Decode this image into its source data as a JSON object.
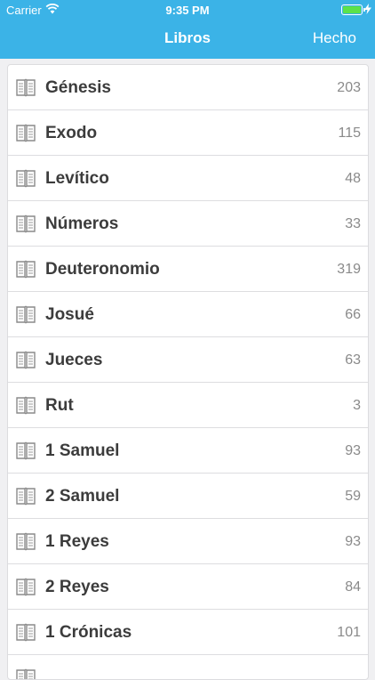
{
  "status_bar": {
    "carrier": "Carrier",
    "time": "9:35 PM"
  },
  "nav": {
    "title": "Libros",
    "done_label": "Hecho"
  },
  "books": [
    {
      "name": "Génesis",
      "count": "203"
    },
    {
      "name": "Exodo",
      "count": "115"
    },
    {
      "name": "Levítico",
      "count": "48"
    },
    {
      "name": "Números",
      "count": "33"
    },
    {
      "name": "Deuteronomio",
      "count": "319"
    },
    {
      "name": "Josué",
      "count": "66"
    },
    {
      "name": "Jueces",
      "count": "63"
    },
    {
      "name": "Rut",
      "count": "3"
    },
    {
      "name": "1 Samuel",
      "count": "93"
    },
    {
      "name": "2 Samuel",
      "count": "59"
    },
    {
      "name": "1 Reyes",
      "count": "93"
    },
    {
      "name": "2 Reyes",
      "count": "84"
    },
    {
      "name": "1 Crónicas",
      "count": "101"
    },
    {
      "name": "",
      "count": ""
    }
  ],
  "colors": {
    "accent": "#3bb3e7",
    "battery": "#5ce24a"
  },
  "icon": "book-icon"
}
